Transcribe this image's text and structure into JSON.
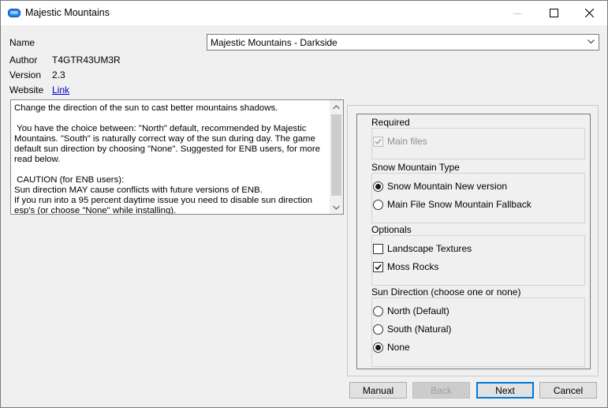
{
  "window": {
    "title": "Majestic Mountains",
    "controls": [
      "minimize-icon",
      "maximize-icon",
      "close-icon"
    ]
  },
  "meta": {
    "name_label": "Name",
    "author_label": "Author",
    "author_value": "T4GTR43UM3R",
    "version_label": "Version",
    "version_value": "2.3",
    "website_label": "Website",
    "website_link_text": "Link"
  },
  "name_select": {
    "value": "Majestic Mountains - Darkside"
  },
  "description": "Change the direction of the sun to cast better mountains shadows.\n\n You have the choice between: \"North\" default, recommended by Majestic Mountains. \"South\" is naturally correct way of the sun during day. The game default sun direction by choosing \"None\". Suggested for ENB users, for more read below.\n\n CAUTION (for ENB users):\nSun direction MAY cause conflicts with future versions of ENB.\nIf you run into a 95 percent daytime issue you need to disable sun direction esp's (or choose \"None\" while installing).",
  "groups": {
    "required": {
      "title": "Required",
      "options": [
        {
          "label": "Main files",
          "type": "checkbox",
          "checked": true,
          "disabled": true
        }
      ]
    },
    "snow": {
      "title": "Snow Mountain Type",
      "options": [
        {
          "label": "Snow Mountain New version",
          "type": "radio",
          "checked": true
        },
        {
          "label": "Main File Snow Mountain Fallback",
          "type": "radio",
          "checked": false
        }
      ]
    },
    "optionals": {
      "title": "Optionals",
      "options": [
        {
          "label": "Landscape Textures",
          "type": "checkbox",
          "checked": false
        },
        {
          "label": "Moss Rocks",
          "type": "checkbox",
          "checked": true
        }
      ]
    },
    "sun": {
      "title": "Sun Direction (choose one or none)",
      "options": [
        {
          "label": "North (Default)",
          "type": "radio",
          "checked": false
        },
        {
          "label": "South (Natural)",
          "type": "radio",
          "checked": false
        },
        {
          "label": "None",
          "type": "radio",
          "checked": true
        }
      ]
    }
  },
  "buttons": {
    "manual": "Manual",
    "back": "Back",
    "next": "Next",
    "cancel": "Cancel"
  },
  "colors": {
    "accent": "#0078d7",
    "link": "#0000cc",
    "app_icon": "#1e88e5"
  }
}
